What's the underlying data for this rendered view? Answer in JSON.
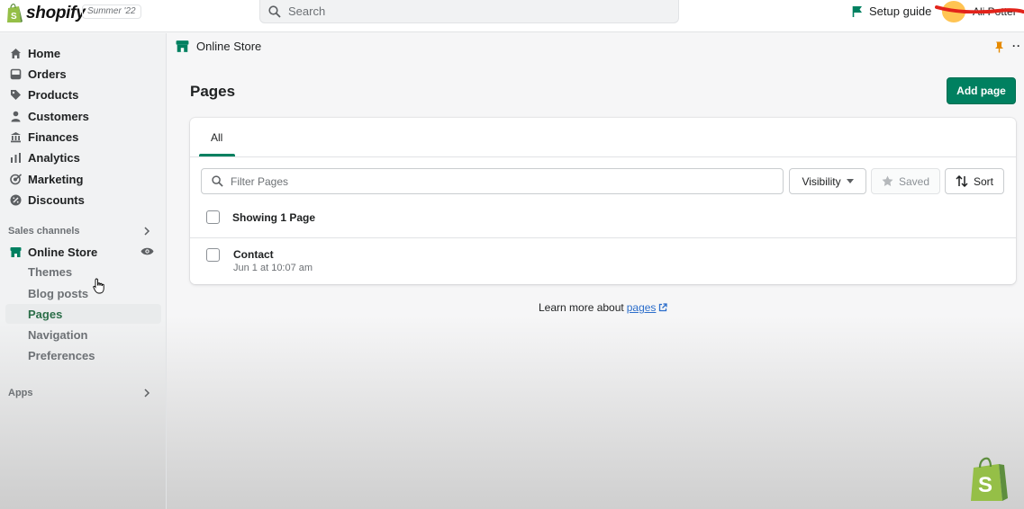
{
  "topbar": {
    "brand": "shopify",
    "edition": "Summer '22",
    "search_placeholder": "Search",
    "setup_guide": "Setup guide",
    "store_name": "Ali Potter"
  },
  "sidebar": {
    "items": [
      {
        "label": "Home",
        "icon": "home-icon"
      },
      {
        "label": "Orders",
        "icon": "orders-icon"
      },
      {
        "label": "Products",
        "icon": "tag-icon"
      },
      {
        "label": "Customers",
        "icon": "person-icon"
      },
      {
        "label": "Finances",
        "icon": "bank-icon"
      },
      {
        "label": "Analytics",
        "icon": "bar-chart-icon"
      },
      {
        "label": "Marketing",
        "icon": "target-icon"
      },
      {
        "label": "Discounts",
        "icon": "discount-icon"
      }
    ],
    "sales_channels_label": "Sales channels",
    "online_store": "Online Store",
    "sub_items": [
      {
        "label": "Themes"
      },
      {
        "label": "Blog posts"
      },
      {
        "label": "Pages"
      },
      {
        "label": "Navigation"
      },
      {
        "label": "Preferences"
      }
    ],
    "apps_label": "Apps"
  },
  "main": {
    "breadcrumb": "Online Store",
    "title": "Pages",
    "add_button": "Add page",
    "tabs": [
      {
        "label": "All"
      }
    ],
    "filter_placeholder": "Filter Pages",
    "visibility_label": "Visibility",
    "saved_label": "Saved",
    "sort_label": "Sort",
    "showing_text": "Showing 1 Page",
    "rows": [
      {
        "title": "Contact",
        "date": "Jun 1 at 10:07 am"
      }
    ],
    "learn_more_text": "Learn more about",
    "learn_more_link": "pages"
  },
  "colors": {
    "primary": "#008060",
    "link": "#2c6ecb",
    "active_nav": "#2c6e49"
  }
}
